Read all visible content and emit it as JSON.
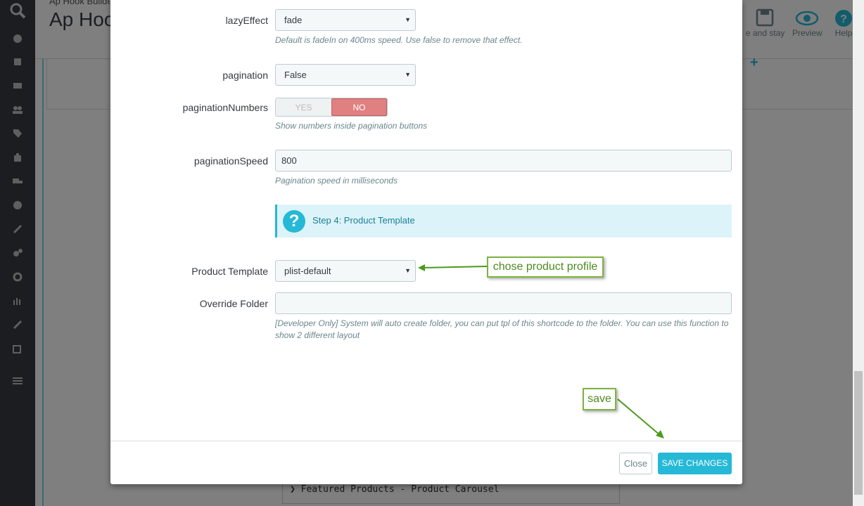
{
  "background": {
    "breadcrumb": "Ap Hook Builder",
    "page_title": "Ap Hoo",
    "toolbar": {
      "save_stay_label": "e and stay",
      "preview_label": "Preview",
      "help_label": "Help"
    },
    "featured_item": "Featured Products - Product Carousel",
    "sidebar_icons": [
      "search-icon",
      "dashboard-icon",
      "orders-icon",
      "catalog-icon",
      "customers-icon",
      "tags-icon",
      "modules-icon",
      "shipping-icon",
      "localization-icon",
      "preferences-icon",
      "advanced-icon",
      "settings-icon",
      "stats-icon",
      "edit-icon",
      "edit2-icon",
      "menu-icon"
    ]
  },
  "modal": {
    "lazy_effect": {
      "label": "lazyEffect",
      "value": "fade",
      "hint": "Default is fadeIn on 400ms speed. Use false to remove that effect."
    },
    "pagination": {
      "label": "pagination",
      "value": "False"
    },
    "pagination_numbers": {
      "label": "paginationNumbers",
      "yes": "YES",
      "no": "NO",
      "selected": "NO",
      "hint": "Show numbers inside pagination buttons"
    },
    "pagination_speed": {
      "label": "paginationSpeed",
      "value": "800",
      "hint": "Pagination speed in milliseconds"
    },
    "step_box": {
      "text": "Step 4: Product Template"
    },
    "product_template": {
      "label": "Product Template",
      "value": "plist-default"
    },
    "override_folder": {
      "label": "Override Folder",
      "value": "",
      "hint": "[Developer Only] System will auto create folder, you can put tpl of this shortcode to the folder. You can use this function to show 2 different layout"
    },
    "footer": {
      "close_label": "Close",
      "save_label": "SAVE CHANGES"
    }
  },
  "annotations": {
    "profile_note": "chose product profile",
    "save_note": "save"
  },
  "colors": {
    "accent": "#25b9d7",
    "switch_no": "#e08080",
    "annotation_border": "#7cb342",
    "sidebar": "#363a41"
  }
}
